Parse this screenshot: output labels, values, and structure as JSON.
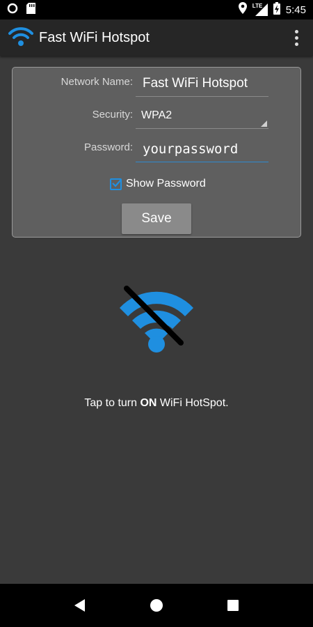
{
  "status_bar": {
    "time": "5:45",
    "network": "LTE",
    "icons": [
      "circle-notification-icon",
      "sd-card-icon",
      "location-icon",
      "signal-icon",
      "battery-charging-icon"
    ]
  },
  "app_bar": {
    "title": "Fast WiFi Hotspot",
    "icon": "wifi-icon",
    "menu_icon": "overflow-menu-icon"
  },
  "form": {
    "network_name_label": "Network Name:",
    "network_name_value": "Fast WiFi Hotspot",
    "security_label": "Security:",
    "security_value": "WPA2",
    "password_label": "Password:",
    "password_value": "yourpassword",
    "show_password_label": "Show Password",
    "show_password_checked": true,
    "save_label": "Save"
  },
  "hotspot": {
    "icon": "wifi-off-icon",
    "tap_prefix": "Tap to turn ",
    "tap_bold": "ON",
    "tap_suffix": " WiFi HotSpot."
  },
  "nav_bar": {
    "icons": [
      "back-icon",
      "home-icon",
      "recents-icon"
    ]
  },
  "colors": {
    "accent": "#1f8fe0",
    "background": "#3a3a3a",
    "panel": "#5f5f5f",
    "app_bar": "#262626"
  }
}
